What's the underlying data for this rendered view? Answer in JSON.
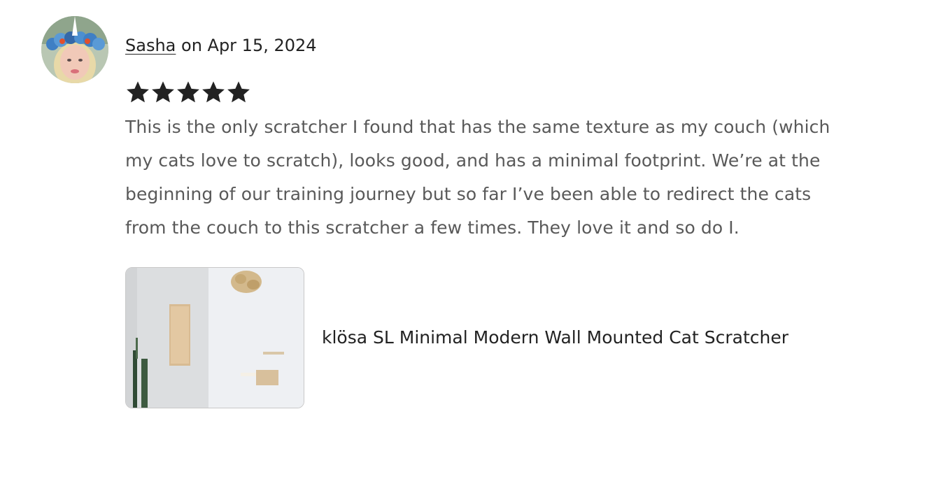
{
  "review": {
    "reviewer_name": "Sasha",
    "date_connector": " on ",
    "date": "Apr 15, 2024",
    "rating": 5,
    "rating_max": 5,
    "star_color": "#222222",
    "text_lines": [
      "This is the only scratcher I found that has the same texture as my couch (which",
      "my cats love to scratch), looks good, and has a minimal footprint. We’re at the",
      "beginning of our training journey but so far I’ve been able to redirect the cats",
      "from the couch to this scratcher a few times. They love it and so do I."
    ]
  },
  "listing": {
    "title": "klösa SL Minimal Modern Wall Mounted Cat Scratcher"
  }
}
